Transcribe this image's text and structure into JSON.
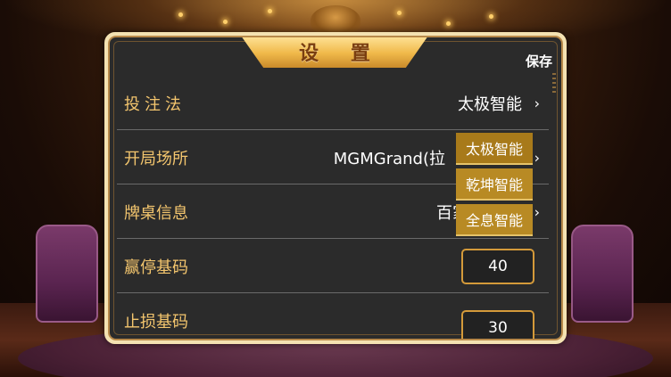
{
  "title": "设 置",
  "save_label": "保存",
  "rows": [
    {
      "label": "投注法",
      "value": "太极智能",
      "arrow": "›"
    },
    {
      "label": "开局场所",
      "value": "MGMGrand(拉",
      "arrow": "›"
    },
    {
      "label": "牌桌信息",
      "value": "百家",
      "arrow": "›"
    },
    {
      "label": "赢停基码",
      "input_value": "40"
    },
    {
      "label": "止损基码",
      "input_value": "30"
    }
  ],
  "dropdown": {
    "options": [
      "太极智能",
      "乾坤智能",
      "全息智能"
    ]
  },
  "colors": {
    "label": "#f4c66e",
    "panel_bg": "#2b2b2b",
    "border_gold": "#d49a3a",
    "dropdown_bg": "#b88a24"
  }
}
